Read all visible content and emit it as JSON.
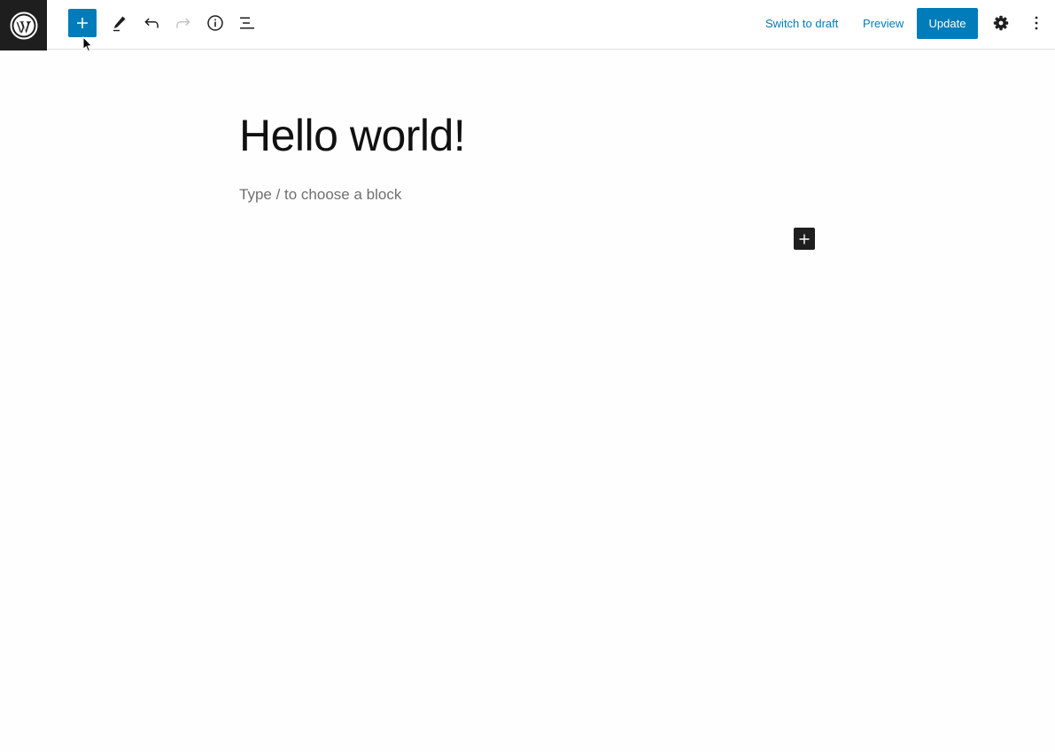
{
  "toolbar": {
    "wordpress_logo": "wordpress-logo",
    "inserter_icon": "plus-icon",
    "tools_icon": "pencil-icon",
    "undo_icon": "undo-icon",
    "redo_icon": "redo-icon",
    "details_icon": "info-icon",
    "list_view_icon": "list-view-icon",
    "switch_to_draft_label": "Switch to draft",
    "preview_label": "Preview",
    "update_label": "Update",
    "settings_icon": "gear-icon",
    "more_icon": "more-vertical-icon"
  },
  "editor": {
    "post_title": "Hello world!",
    "block_placeholder": "Type / to choose a block",
    "block_inserter_icon": "plus-icon"
  },
  "colors": {
    "accent": "#007cba",
    "dark": "#1e1e1e",
    "text": "#111111",
    "placeholder": "#6f6f6f",
    "disabled_icon": "#c3c3c3"
  }
}
